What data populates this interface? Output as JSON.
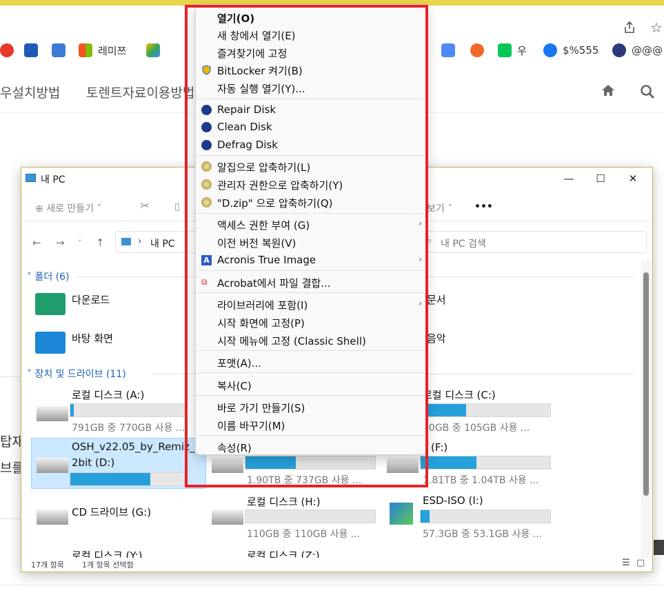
{
  "bookmarks": [
    "레미쯔",
    "우",
    "$%555",
    "@@@"
  ],
  "site_nav": {
    "menu1": "우설치방법",
    "menu2": "토렌트자료이용방법"
  },
  "background_text": {
    "t1": "탑재",
    "t2": "브를"
  },
  "explorer": {
    "title": "내 PC",
    "new_button": "새로 만들기",
    "view_button": "보기",
    "more": "•••",
    "address": "내 PC",
    "search_placeholder": "내 PC 검색",
    "folders_header": "폴더 (6)",
    "folders": [
      "다운로드",
      "바탕 화면",
      "문서",
      "음악"
    ],
    "drives_header": "장치 및 드라이브 (11)",
    "drives": [
      {
        "name": "로컬 디스크 (A:)",
        "info": "791GB 중 770GB 사용 ...",
        "used_pct": 3
      },
      {
        "name": "로컬 디스크 (C:)",
        "info": "60GB 중 105GB 사용 ...",
        "used_pct": 35
      },
      {
        "name": "OSH_v22.05_by_Remiz_3",
        "name2": "2bit (D:)",
        "used_pct": 60
      },
      {
        "name": "1.90TB 중 737GB 사용 ...",
        "used_pct": 39
      },
      {
        "name": "(F:)",
        "info": "1.81TB 중 1.04TB 사용 ...",
        "used_pct": 43
      },
      {
        "name": "CD 드라이브 (G:)"
      },
      {
        "name": "로컬 디스크 (H:)",
        "info": "110GB 중 110GB 사용 ...",
        "used_pct": 0
      },
      {
        "name": "ESD-ISO (I:)",
        "info": "57.3GB 중 53.1GB 사용 ...",
        "used_pct": 7
      },
      {
        "name": "로컬 디스크 (Y:)"
      },
      {
        "name": "로컬 디스크 (Z:)"
      }
    ],
    "status_left": "17개 항목",
    "status_mid": "1개 항목 선택함"
  },
  "context_menu": {
    "items": [
      "열기(O)",
      "새 창에서 열기(E)",
      "즐겨찾기에 고정",
      "BitLocker 켜기(B)",
      "자동 실행 열기(Y)...",
      "Repair Disk",
      "Clean Disk",
      "Defrag Disk",
      "알집으로 압축하기(L)",
      "관리자 권한으로 압축하기(Y)",
      "\"D.zip\" 으로 압축하기(Q)",
      "액세스 권한 부여 (G)",
      "이전 버전 복원(V)",
      "Acronis True Image",
      "Acrobat에서 파일 결합...",
      "라이브러리에 포함(I)",
      "시작 화면에 고정(P)",
      "시작 메뉴에 고정 (Classic Shell)",
      "포맷(A)...",
      "복사(C)",
      "바로 가기 만들기(S)",
      "이름 바꾸기(M)",
      "속성(R)"
    ]
  }
}
